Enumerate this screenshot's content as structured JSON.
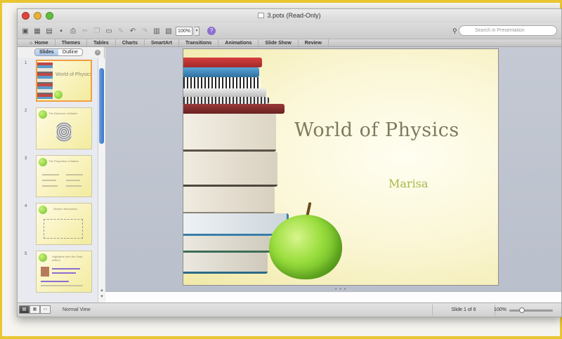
{
  "window": {
    "title": "3.potx (Read-Only)"
  },
  "toolbar": {
    "zoom_value": "100%",
    "search_placeholder": "Search in Presentation",
    "icons": [
      "new-icon",
      "templates-icon",
      "open-icon",
      "save-icon",
      "print-icon",
      "cut-icon",
      "copy-icon",
      "paste-icon",
      "format-icon",
      "undo-icon",
      "redo-icon",
      "media-icon",
      "gallery-icon",
      "zoom-icon",
      "help-icon"
    ]
  },
  "ribbon": {
    "tabs": [
      {
        "label": "Home",
        "icon": "home-icon"
      },
      {
        "label": "Themes"
      },
      {
        "label": "Tables"
      },
      {
        "label": "Charts"
      },
      {
        "label": "SmartArt"
      },
      {
        "label": "Transitions"
      },
      {
        "label": "Animations"
      },
      {
        "label": "Slide Show"
      },
      {
        "label": "Review"
      }
    ]
  },
  "leftpane": {
    "segments": [
      "Slides",
      "Outline"
    ],
    "active_segment": "Slides",
    "thumbnails": [
      {
        "number": "1",
        "title": "World of Physics",
        "selected": true
      },
      {
        "number": "2",
        "title": "The Structure of Matter"
      },
      {
        "number": "3",
        "title": "The Properties of Matter"
      },
      {
        "number": "4",
        "title": "Newton Mechanics"
      },
      {
        "number": "5",
        "title": "Highlights from the Daily edition"
      }
    ]
  },
  "slide": {
    "title": "World of Physics",
    "subtitle": "Marisa",
    "colors": {
      "title": "#7d7b5d",
      "subtitle": "#a6b84a",
      "accent_apple": "#8fd43a"
    }
  },
  "status": {
    "view_label": "Normal View",
    "slide_indicator": "Slide 1 of 6",
    "zoom": "100%",
    "zoom_level_fraction": 0.25
  }
}
